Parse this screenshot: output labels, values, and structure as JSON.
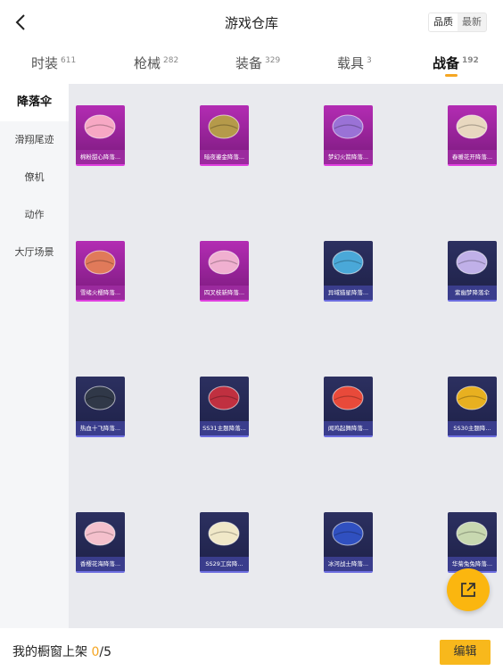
{
  "header": {
    "title": "游戏仓库",
    "sort_quality": "品质",
    "sort_latest": "最新"
  },
  "tabs": [
    {
      "label": "时装",
      "count": "611"
    },
    {
      "label": "枪械",
      "count": "282"
    },
    {
      "label": "装备",
      "count": "329"
    },
    {
      "label": "载具",
      "count": "3"
    },
    {
      "label": "战备",
      "count": "192"
    }
  ],
  "active_tab": "战备",
  "sidebar": [
    "降落伞",
    "滑翔尾迹",
    "僚机",
    "动作",
    "大厅场景"
  ],
  "active_sidebar": "降落伞",
  "items": [
    {
      "name": "棉粉甜心降落...",
      "rarity": "pink",
      "color": "#f7a8c4"
    },
    {
      "name": "暗夜鎏金降落...",
      "rarity": "pink",
      "color": "#b59a4a"
    },
    {
      "name": "梦幻火箭降落...",
      "rarity": "pink",
      "color": "#9a72d6"
    },
    {
      "name": "春暖花开降落...",
      "rarity": "pink",
      "color": "#e8d8c0"
    },
    {
      "name": "雪绪火樱降落...",
      "rarity": "pink",
      "color": "#e07a5a"
    },
    {
      "name": "四叉枝新降落...",
      "rarity": "pink",
      "color": "#f0b0d0"
    },
    {
      "name": "异域猎星降落...",
      "rarity": "blue",
      "color": "#4aa8d8"
    },
    {
      "name": "紫幽梦降落伞",
      "rarity": "blue",
      "color": "#c0b0e8"
    },
    {
      "name": "热血十飞降落...",
      "rarity": "blue",
      "color": "#303848"
    },
    {
      "name": "SS31主题降落...",
      "rarity": "blue",
      "color": "#c03040"
    },
    {
      "name": "闻鸡起舞降落...",
      "rarity": "blue",
      "color": "#e84a3a"
    },
    {
      "name": "SS30主题降...",
      "rarity": "blue",
      "color": "#e8b020"
    },
    {
      "name": "香樱花海降落...",
      "rarity": "blue",
      "color": "#f4c0cc"
    },
    {
      "name": "SS29工房降...",
      "rarity": "blue",
      "color": "#f0e8c8"
    },
    {
      "name": "冰河战士降落...",
      "rarity": "blue",
      "color": "#3050c0"
    },
    {
      "name": "华菊兔兔降落...",
      "rarity": "blue",
      "color": "#c8d8b0"
    }
  ],
  "footer": {
    "label": "我的橱窗上架 ",
    "current": "0",
    "total": "/5",
    "edit_label": "编辑"
  },
  "accent": "#f5a623"
}
